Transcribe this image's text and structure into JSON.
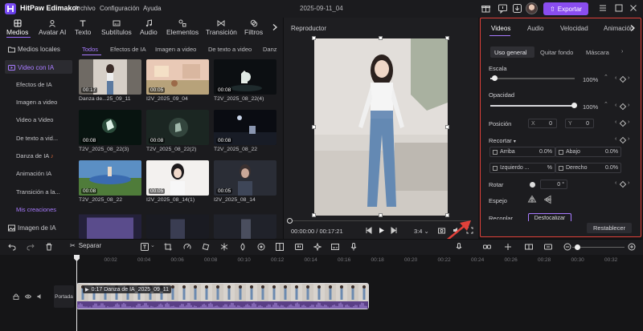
{
  "app": {
    "name": "HitPaw Edimakor",
    "menus": [
      "Archivo",
      "Configuración",
      "Ayuda"
    ],
    "doc_title": "2025-09-11_04",
    "export_label": "Exportar"
  },
  "toolbar": {
    "tools": [
      "Medios",
      "Avatar AI",
      "Texto",
      "Subtítulos",
      "Audio",
      "Elementos",
      "Transición",
      "Filtros"
    ]
  },
  "leftnav": {
    "items": [
      "Medios locales",
      "Video con IA",
      "Efectos de IA",
      "Imagen a video",
      "Video a Video",
      "De texto a vid...",
      "Danza de IA",
      "Animación IA",
      "Transición a la...",
      "Mis creaciones",
      "Imagen de IA"
    ]
  },
  "media": {
    "tabs": [
      "Todos",
      "Efectos de IA",
      "Imagen a video",
      "De texto a video",
      "Danz"
    ],
    "items": [
      {
        "dur": "00:17",
        "caption": "Danza de...25_09_11"
      },
      {
        "dur": "00:05",
        "caption": "I2V_2025_09_04"
      },
      {
        "dur": "00:08",
        "caption": "T2V_2025_08_22(4)"
      },
      {
        "dur": "00:08",
        "caption": "T2V_2025_08_22(3)"
      },
      {
        "dur": "00:08",
        "caption": "T2V_2025_08_22(2)"
      },
      {
        "dur": "00:08",
        "caption": "T2V_2025_08_22"
      },
      {
        "dur": "00:08",
        "caption": "T2V_2025_08_22"
      },
      {
        "dur": "00:05",
        "caption": "I2V_2025_08_14(1)"
      },
      {
        "dur": "00:05",
        "caption": "I2V_2025_08_14"
      }
    ]
  },
  "player": {
    "title": "Reproductor",
    "time": "00:00:00 / 00:17:21",
    "ratio": "3:4"
  },
  "props": {
    "tabs": [
      "Videos",
      "Audio",
      "Velocidad",
      "Animación"
    ],
    "subtabs": [
      "Uso general",
      "Quitar fondo",
      "Máscara"
    ],
    "scale": {
      "label": "Escala",
      "value": "100%",
      "level": 0.05
    },
    "opacity": {
      "label": "Opacidad",
      "value": "100%",
      "level": 1.0
    },
    "position": {
      "label": "Posición",
      "x_label": "X",
      "x": "0",
      "y_label": "Y",
      "y": "0"
    },
    "crop": {
      "label": "Recortar",
      "top": "Arriba",
      "top_val": "0.0%",
      "bottom": "Abajo",
      "bottom_val": "0.0%",
      "left": "Izquierdo ...",
      "left_val": "%",
      "right": "Derecho",
      "right_val": "0.0%"
    },
    "rotate": {
      "label": "Rotar",
      "value": "0",
      "unit": "°"
    },
    "mirror": {
      "label": "Espejo"
    },
    "blend": {
      "label": "Recoplar",
      "value": "Desfocalizar"
    },
    "reset_label": "Restablecer"
  },
  "timeline": {
    "separate_label": "Separar",
    "ticks": [
      "00:00",
      "00:02",
      "00:04",
      "00:06",
      "00:08",
      "00:10",
      "00:12",
      "00:14",
      "00:16",
      "00:18",
      "00:20",
      "00:22",
      "00:24",
      "00:26",
      "00:28",
      "00:30",
      "00:32"
    ],
    "clip_label": "0:17 Danza de IA_2025_09_11",
    "cover_label": "Portada"
  },
  "colors": {
    "accent": "#9a6bff",
    "highlight_box": "#e0413a"
  }
}
